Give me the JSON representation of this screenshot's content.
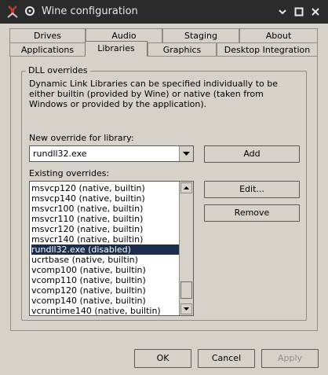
{
  "window": {
    "title": "Wine configuration"
  },
  "tabs_row1": [
    "Drives",
    "Audio",
    "Staging",
    "About"
  ],
  "tabs_row2": [
    "Applications",
    "Libraries",
    "Graphics",
    "Desktop Integration"
  ],
  "active_tab": "Libraries",
  "group": {
    "title": "DLL overrides",
    "description": "Dynamic Link Libraries can be specified individually to be either builtin (provided by Wine) or native (taken from Windows or provided by the application)."
  },
  "new_override": {
    "label": "New override for library:",
    "value": "rundll32.exe"
  },
  "existing": {
    "label": "Existing overrides:",
    "items": [
      "msvcp120 (native, builtin)",
      "msvcp140 (native, builtin)",
      "msvcr100 (native, builtin)",
      "msvcr110 (native, builtin)",
      "msvcr120 (native, builtin)",
      "msvcr140 (native, builtin)",
      "rundll32.exe (disabled)",
      "ucrtbase (native, builtin)",
      "vcomp100 (native, builtin)",
      "vcomp110 (native, builtin)",
      "vcomp120 (native, builtin)",
      "vcomp140 (native, builtin)",
      "vcruntime140 (native, builtin)"
    ],
    "selected_index": 6
  },
  "buttons": {
    "add": "Add",
    "edit": "Edit...",
    "remove": "Remove",
    "ok": "OK",
    "cancel": "Cancel",
    "apply": "Apply"
  }
}
